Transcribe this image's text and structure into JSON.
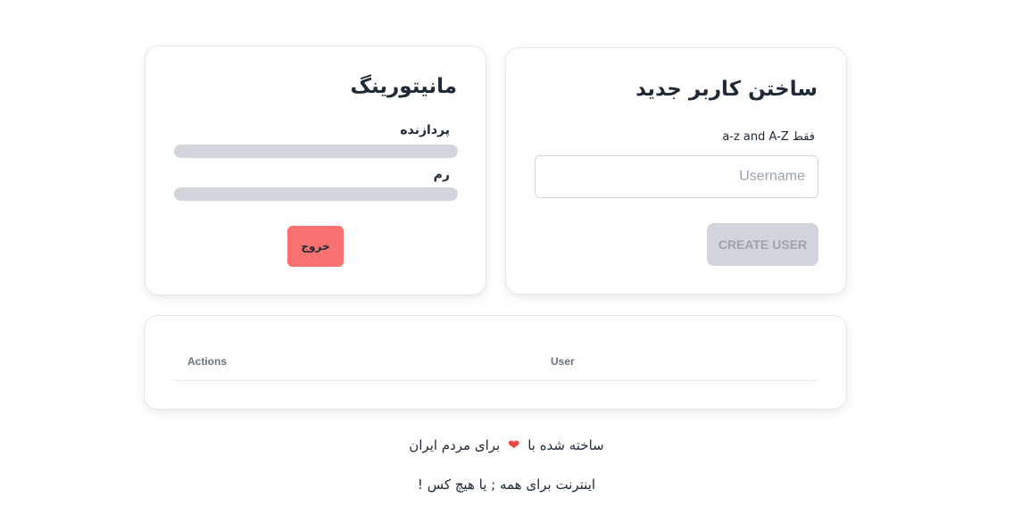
{
  "create_user": {
    "title": "ساختن کاربر جدید",
    "hint": "فقط a-z and A-Z",
    "username_placeholder": "Username",
    "username_value": "",
    "button_label": "CREATE USER"
  },
  "monitoring": {
    "title": "مانیتورینگ",
    "cpu_label": "پردازنده",
    "cpu_percent": 0,
    "ram_label": "رم",
    "ram_percent": 0,
    "logout_label": "خروج"
  },
  "users_table": {
    "columns": [
      "User",
      "Actions"
    ],
    "rows": []
  },
  "footer": {
    "line1_before": "ساخته شده با",
    "heart_icon": "heart-icon",
    "line1_after": "برای مردم ایران",
    "line2": "اینترنت برای همه ; یا هیچ کس !"
  },
  "colors": {
    "danger": "#f87171",
    "heart": "#ef4444",
    "disabled": "#d1d5db"
  }
}
